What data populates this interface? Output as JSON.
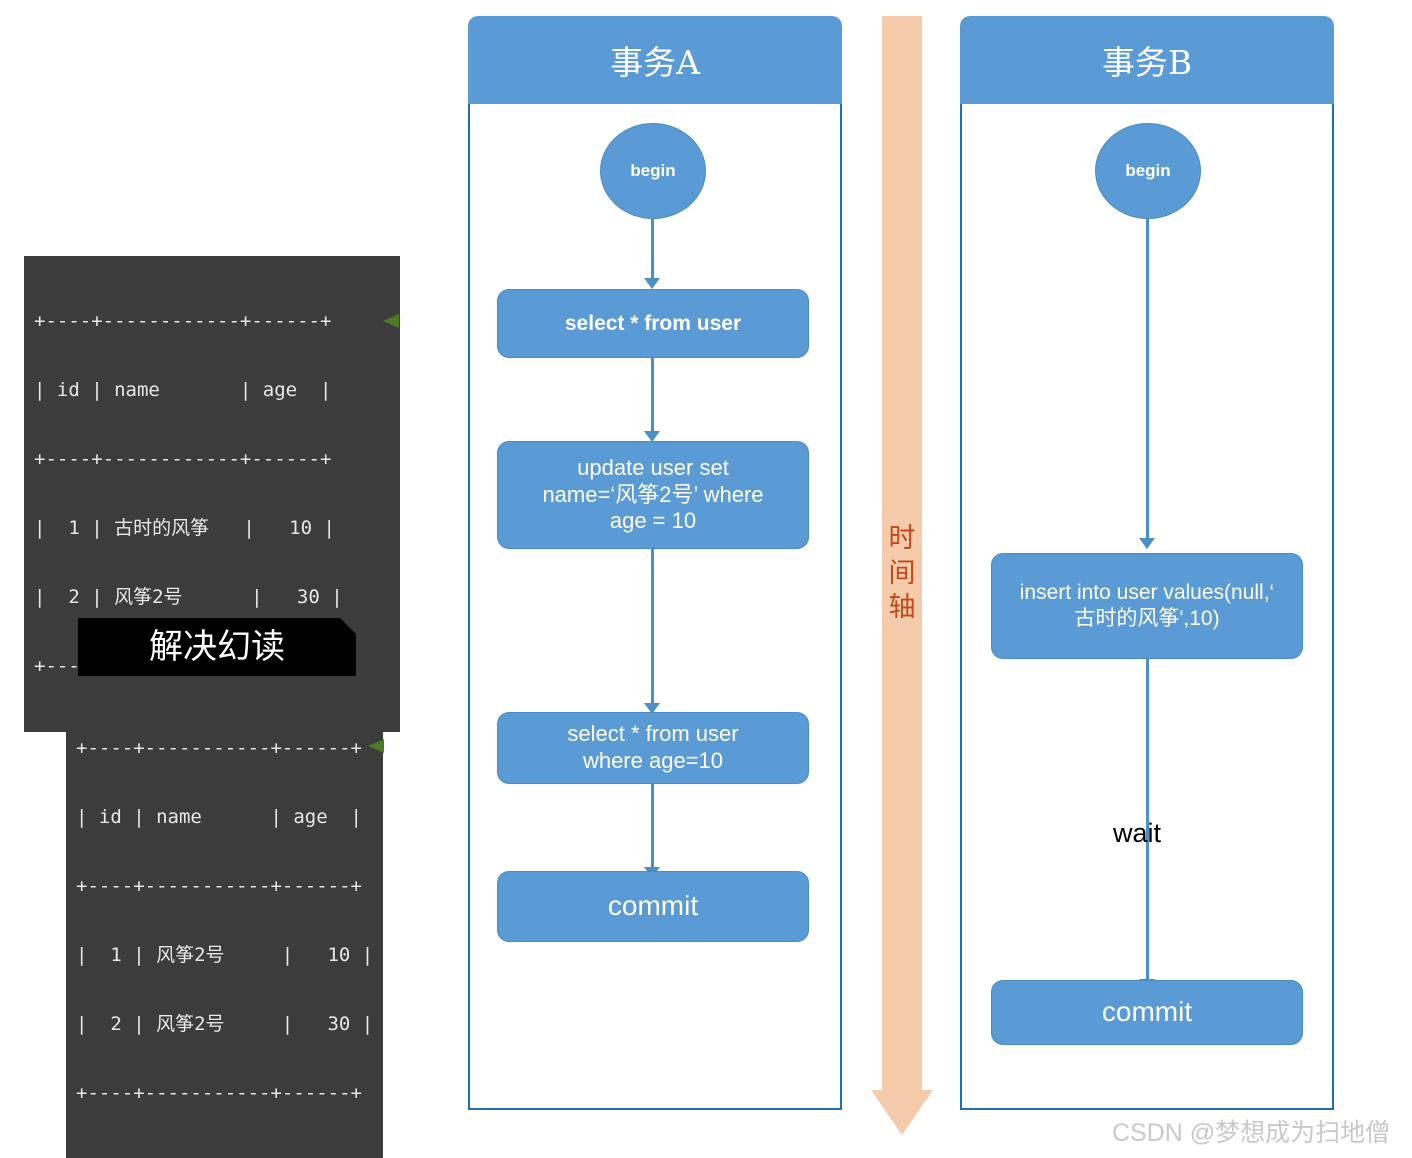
{
  "diagram": {
    "watermark": "CSDN @梦想成为扫地僧"
  },
  "time_axis": {
    "label": "时间轴",
    "color": "#f5cbac",
    "text_color": "#c1491a"
  },
  "lanes": [
    {
      "id": "transaction-a",
      "title": "事务A",
      "nodes": [
        {
          "id": "begin-a",
          "label": "begin",
          "shape": "circle"
        },
        {
          "id": "select-all-a",
          "label": "select * from user",
          "shape": "rounded-rect"
        },
        {
          "id": "update-a",
          "label": "update user set\nname=‘风筝2号’ where\nage = 10",
          "shape": "rounded-rect"
        },
        {
          "id": "select-where-a",
          "label": "select * from user\nwhere age=10",
          "shape": "rounded-rect"
        },
        {
          "id": "commit-a",
          "label": "commit",
          "shape": "rounded-rect"
        }
      ]
    },
    {
      "id": "transaction-b",
      "title": "事务B",
      "nodes": [
        {
          "id": "begin-b",
          "label": "begin",
          "shape": "circle"
        },
        {
          "id": "insert-b",
          "label": "insert into user values(null,‘\n古时的风筝',10)",
          "shape": "rounded-rect"
        },
        {
          "id": "wait-b",
          "label": "wait",
          "shape": "text"
        },
        {
          "id": "commit-b",
          "label": "commit",
          "shape": "rounded-rect"
        }
      ]
    }
  ],
  "result_tables": [
    {
      "id": "result-table-1",
      "banner": null,
      "columns": [
        "id",
        "name",
        "age"
      ],
      "rows": [
        {
          "id": "1",
          "name": "古时的风筝",
          "age": "10"
        },
        {
          "id": "2",
          "name": "风筝2号",
          "age": "30"
        }
      ],
      "lines": [
        "+----+------------+------+",
        "| id | name       | age  |",
        "+----+------------+------+",
        "|  1 | 古时的风筝   |   10 |",
        "|  2 | 风筝2号      |   30 |",
        "+----+------------+------+"
      ]
    },
    {
      "id": "result-table-2",
      "banner": "解决幻读",
      "columns": [
        "id",
        "name",
        "age"
      ],
      "rows": [
        {
          "id": "1",
          "name": "风筝2号",
          "age": "10"
        },
        {
          "id": "2",
          "name": "风筝2号",
          "age": "30"
        }
      ],
      "lines": [
        "+----+-----------+------+",
        "| id | name      | age  |",
        "+----+-----------+------+",
        "|  1 | 风筝2号     |   10 |",
        "|  2 | 风筝2号     |   30 |",
        "+----+-----------+------+"
      ]
    }
  ]
}
